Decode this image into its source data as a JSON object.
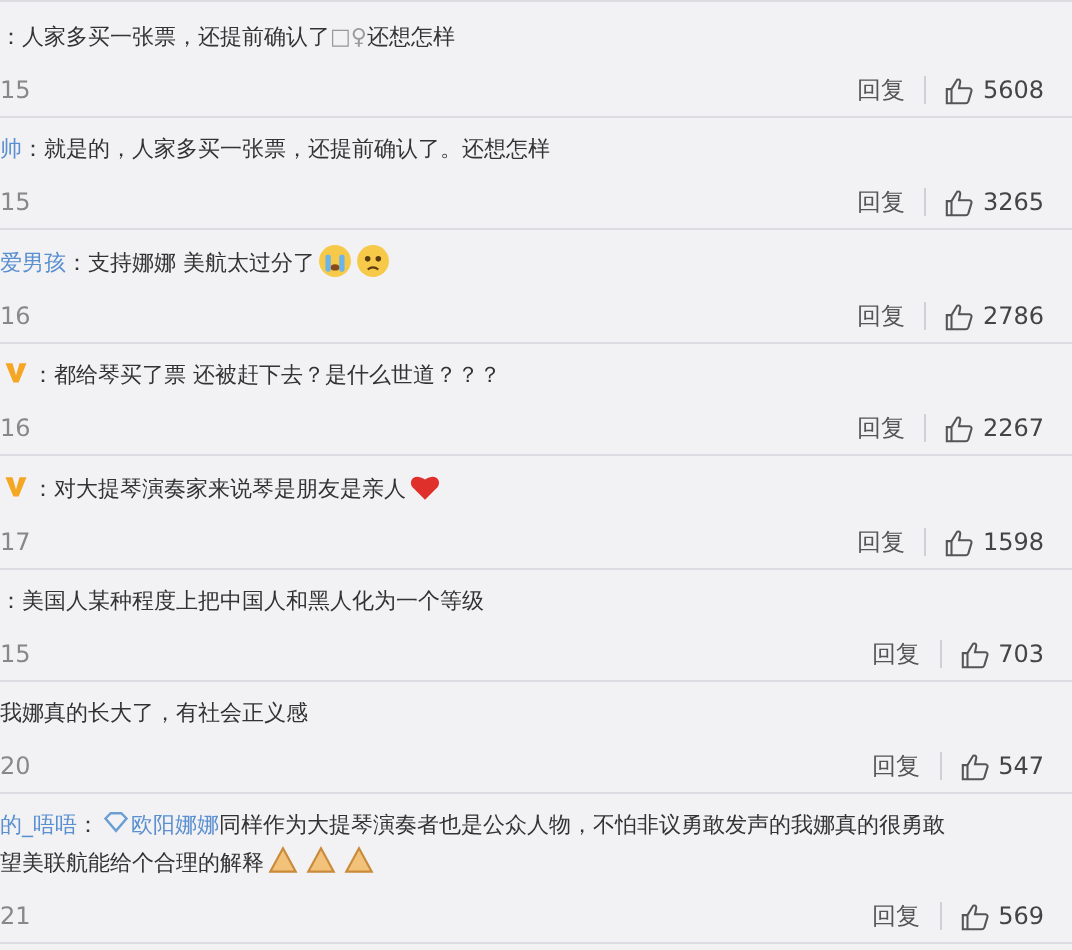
{
  "comments": [
    {
      "parts": [
        {
          "kind": "text",
          "t": "：人家多买一张票，还提前确认了"
        },
        {
          "kind": "glyph",
          "t": "□♀"
        },
        {
          "kind": "text",
          "t": "还想怎样"
        }
      ],
      "time": "15",
      "reply": "回复",
      "likes": "5608"
    },
    {
      "user": "帅",
      "parts": [
        {
          "kind": "text",
          "t": "：就是的，人家多买一张票，还提前确认了。还想怎样"
        }
      ],
      "time": "15",
      "reply": "回复",
      "likes": "3265"
    },
    {
      "user": "爱男孩",
      "parts": [
        {
          "kind": "text",
          "t": "：支持娜娜 美航太过分了"
        },
        {
          "kind": "crying"
        },
        {
          "kind": "sad"
        }
      ],
      "time": "16",
      "reply": "回复",
      "likes": "2786"
    },
    {
      "parts": [
        {
          "kind": "vip"
        },
        {
          "kind": "text",
          "t": "：都给琴买了票 还被赶下去？是什么世道？？？"
        }
      ],
      "time": "16",
      "reply": "回复",
      "likes": "2267"
    },
    {
      "parts": [
        {
          "kind": "vip"
        },
        {
          "kind": "text",
          "t": "：对大提琴演奏家来说琴是朋友是亲人"
        },
        {
          "kind": "heart"
        }
      ],
      "time": "17",
      "reply": "回复",
      "likes": "1598"
    },
    {
      "parts": [
        {
          "kind": "text",
          "t": "：美国人某种程度上把中国人和黑人化为一个等级"
        }
      ],
      "time": "15",
      "reply": "回复",
      "likes": "703"
    },
    {
      "parts": [
        {
          "kind": "text",
          "t": "我娜真的长大了，有社会正义感"
        }
      ],
      "time": "20",
      "reply": "回复",
      "likes": "547"
    },
    {
      "user": "的_唔唔",
      "parts": [
        {
          "kind": "text",
          "t": "："
        },
        {
          "kind": "diamond"
        },
        {
          "kind": "mention",
          "t": "欧阳娜娜"
        },
        {
          "kind": "text",
          "t": "同样作为大提琴演奏者也是公众人物，不怕非议勇敢发声的我娜真的很勇敢"
        },
        {
          "kind": "break"
        },
        {
          "kind": "text",
          "t": "望美联航能给个合理的解释"
        },
        {
          "kind": "pray"
        },
        {
          "kind": "pray"
        },
        {
          "kind": "pray"
        }
      ],
      "time": "21",
      "reply": "回复",
      "likes": "569"
    }
  ]
}
